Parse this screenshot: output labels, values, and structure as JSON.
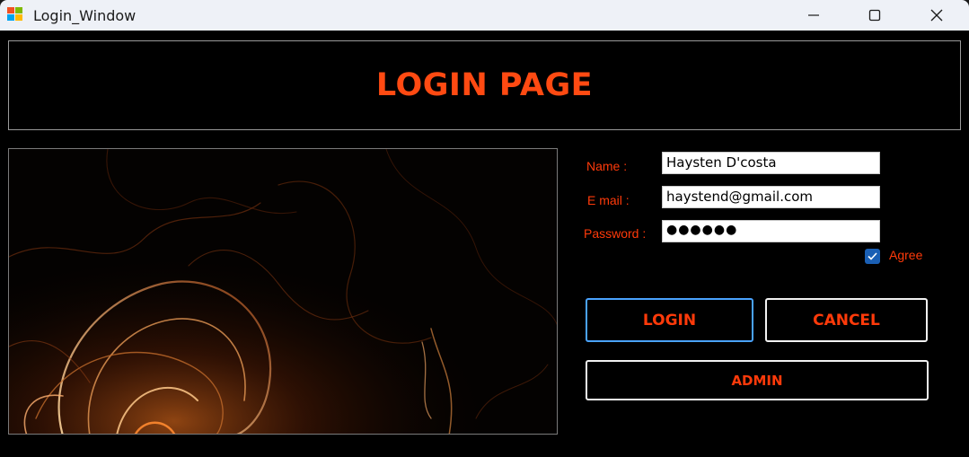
{
  "window": {
    "title": "Login_Window",
    "icon": "winforms-app-icon",
    "controls": [
      "minimize-icon",
      "maximize-icon",
      "close-icon"
    ]
  },
  "banner": {
    "title": "LOGIN PAGE"
  },
  "form": {
    "name_label": "Name :",
    "name_value": "Haysten D'costa",
    "email_label": "E mail :",
    "email_value": "haystend@gmail.com",
    "password_label": "Password :",
    "password_mask": "●●●●●●",
    "agree_label": "Agree",
    "agree_checked": true
  },
  "buttons": {
    "login": "LOGIN",
    "cancel": "CANCEL",
    "admin": "ADMIN"
  },
  "colors": {
    "accent": "#ff3a0a",
    "title": "#ff4a12",
    "background": "#000000",
    "titlebar": "#eef1f7",
    "focus": "#4aa3ff",
    "checkbox": "#1a5fb4"
  }
}
